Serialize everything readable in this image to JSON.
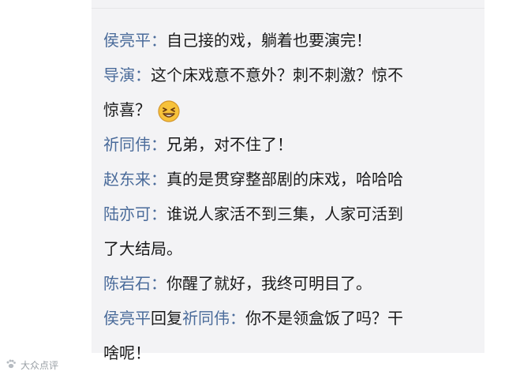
{
  "comments": [
    {
      "name": "侯亮平",
      "sep": "：",
      "text": "自己接的戏，躺着也要演完！"
    },
    {
      "name": "导演",
      "sep": "：",
      "text": "这个床戏意不意外？刺不刺激？惊不",
      "continued": "惊喜？",
      "emoji": "grinning-squint-face-icon"
    },
    {
      "name": "祈同伟",
      "sep": "：",
      "text": "兄弟，对不住了！"
    },
    {
      "name": "赵东来",
      "sep": "：",
      "text": "真的是贯穿整部剧的床戏，哈哈哈"
    },
    {
      "name": "陆亦可",
      "sep": "：",
      "text": "谁说人家活不到三集，人家可活到",
      "continued": "了大结局。"
    },
    {
      "name": "陈岩石",
      "sep": "：",
      "text": "你醒了就好，我终可明目了。"
    },
    {
      "name": "侯亮平",
      "reply_word": "回复",
      "reply_to": "祈同伟",
      "sep": "：",
      "text": "你不是领盒饭了吗？干",
      "continued": "啥呢！"
    }
  ],
  "watermark": {
    "text": "大众点评",
    "icon": "paw-logo-icon"
  },
  "colors": {
    "name": "#4a6b9a",
    "text": "#1a1a1a",
    "panel_bg": "#f3f3f5",
    "emoji_fill": "#f7c23a"
  }
}
